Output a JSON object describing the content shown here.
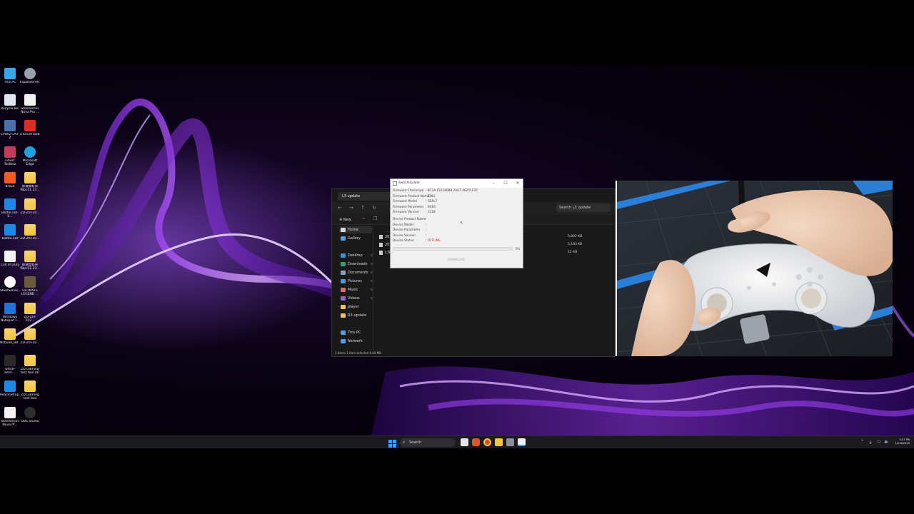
{
  "desktop": {
    "icons": [
      {
        "label": "This PC",
        "icon": "monitor-icon"
      },
      {
        "label": "EqualizerAP...",
        "icon": "equalizer-icon"
      },
      {
        "label": "Recycle Bin",
        "icon": "recycle-bin-icon"
      },
      {
        "label": "SteelSeries Nova Pro ...",
        "icon": "document-icon"
      },
      {
        "label": "CPUID CPU-Z",
        "icon": "cpuz-icon"
      },
      {
        "label": "uTuFuelTaoB...",
        "icon": "pdf-icon"
      },
      {
        "label": "Ghost Toolbox",
        "icon": "ghost-toolbox-icon"
      },
      {
        "label": "Microsoft Edge",
        "icon": "edge-icon"
      },
      {
        "label": "Brave",
        "icon": "brave-icon"
      },
      {
        "label": "新增資料夾 fBpc11.23...",
        "icon": "folder-icon"
      },
      {
        "label": "Battle.net-S...",
        "icon": "battlenet-icon"
      },
      {
        "label": "ZD-Z0I-20...",
        "icon": "folder-icon"
      },
      {
        "label": "Battle.net",
        "icon": "battlenet-icon"
      },
      {
        "label": "ZD-Z0I-20...",
        "icon": "folder-icon"
      },
      {
        "label": "Call of Duty",
        "icon": "document-icon"
      },
      {
        "label": "新增資料夾 fBpc11.23...",
        "icon": "folder-icon"
      },
      {
        "label": "SteelSeries...",
        "icon": "steelseries-icon"
      },
      {
        "label": "ULTIMATE LEGEND ...",
        "icon": "game-icon"
      },
      {
        "label": "Windows Notepad I...",
        "icon": "download-icon"
      },
      {
        "label": "ZD-Z0I-202...",
        "icon": "folder-icon"
      },
      {
        "label": "Ncbuild_BB...",
        "icon": "folder-icon"
      },
      {
        "label": "ZD-Z0I-20...",
        "icon": "folder-icon"
      },
      {
        "label": "wfndl-amd-...",
        "icon": "app-icon"
      },
      {
        "label": "ZD Gaming test tool.rar",
        "icon": "folder-icon"
      },
      {
        "label": "PeaceSetup...",
        "icon": "gear-icon"
      },
      {
        "label": "ZD Gaming test tool",
        "icon": "folder-icon"
      },
      {
        "label": "SteelSeries Nova Pr...",
        "icon": "document-icon"
      },
      {
        "label": "OBS Studio",
        "icon": "obs-icon"
      }
    ]
  },
  "explorer": {
    "tab_title": "L3 update",
    "search_placeholder": "Search L3 update",
    "new_label": "New",
    "sidebar": [
      {
        "label": "Home",
        "icon": "home-icon",
        "color": "#d9d9d9",
        "active": true
      },
      {
        "label": "Gallery",
        "icon": "gallery-icon",
        "color": "#4aa3f0"
      },
      {
        "label": "Desktop",
        "icon": "desktop-icon",
        "color": "#3a8fe0"
      },
      {
        "label": "Downloads",
        "icon": "download-icon",
        "color": "#2fa36b"
      },
      {
        "label": "Documents",
        "icon": "documents-icon",
        "color": "#8aa0b8"
      },
      {
        "label": "Pictures",
        "icon": "pictures-icon",
        "color": "#3f9be8"
      },
      {
        "label": "Music",
        "icon": "music-icon",
        "color": "#e86a5a"
      },
      {
        "label": "Videos",
        "icon": "videos-icon",
        "color": "#9a5ae8"
      },
      {
        "label": "player",
        "icon": "folder-icon",
        "color": "#f2c443"
      },
      {
        "label": "R3-update",
        "icon": "folder-icon",
        "color": "#f2c443"
      },
      {
        "label": "This PC",
        "icon": "this-pc-icon",
        "color": "#4aa3f0"
      },
      {
        "label": "Network",
        "icon": "network-icon",
        "color": "#4aa3f0"
      }
    ],
    "files": [
      {
        "name": "2025",
        "size": "5,802 KB"
      },
      {
        "name": "2025",
        "size": "5,183 KB"
      },
      {
        "name": "L3B",
        "size": "12 KB"
      }
    ],
    "status": "3 items    1 item selected  6.64 MB"
  },
  "dialog": {
    "title": "SwitchUpdate",
    "fields": [
      {
        "key": "Firmware Checksum",
        "value": ": 8C3A F5518088 2A07 A8251F05"
      },
      {
        "key": "Firmware Product Name",
        "value": ": ZDIU"
      },
      {
        "key": "Firmware Model",
        "value": ": SEAL7"
      },
      {
        "key": "Firmware Parameter",
        "value": ": 0016"
      },
      {
        "key": "Firmware Version",
        "value": ": 1118"
      }
    ],
    "device_fields": [
      {
        "key": "Device Product Name",
        "value": ":"
      },
      {
        "key": "Device Model",
        "value": ":"
      },
      {
        "key": "Device Parameter",
        "value": ":"
      },
      {
        "key": "Device Version",
        "value": ":"
      },
      {
        "key": "Device Status",
        "value": ": OFFLINE",
        "color": "#d22222"
      }
    ],
    "progress_percent": 0,
    "progress_label": "0%",
    "download_label": "DOWNLOAD"
  },
  "taskbar": {
    "search_label": "Search",
    "time": "5:37 PM",
    "date": "12/16/2025",
    "apps": [
      "start-icon",
      "task-view-icon",
      "brave-icon",
      "chrome-icon",
      "file-explorer-icon",
      "app-icon",
      "switchupdate-icon"
    ]
  },
  "colors": {
    "accent_purple": "#8a3fd1",
    "offline_red": "#d22222"
  }
}
